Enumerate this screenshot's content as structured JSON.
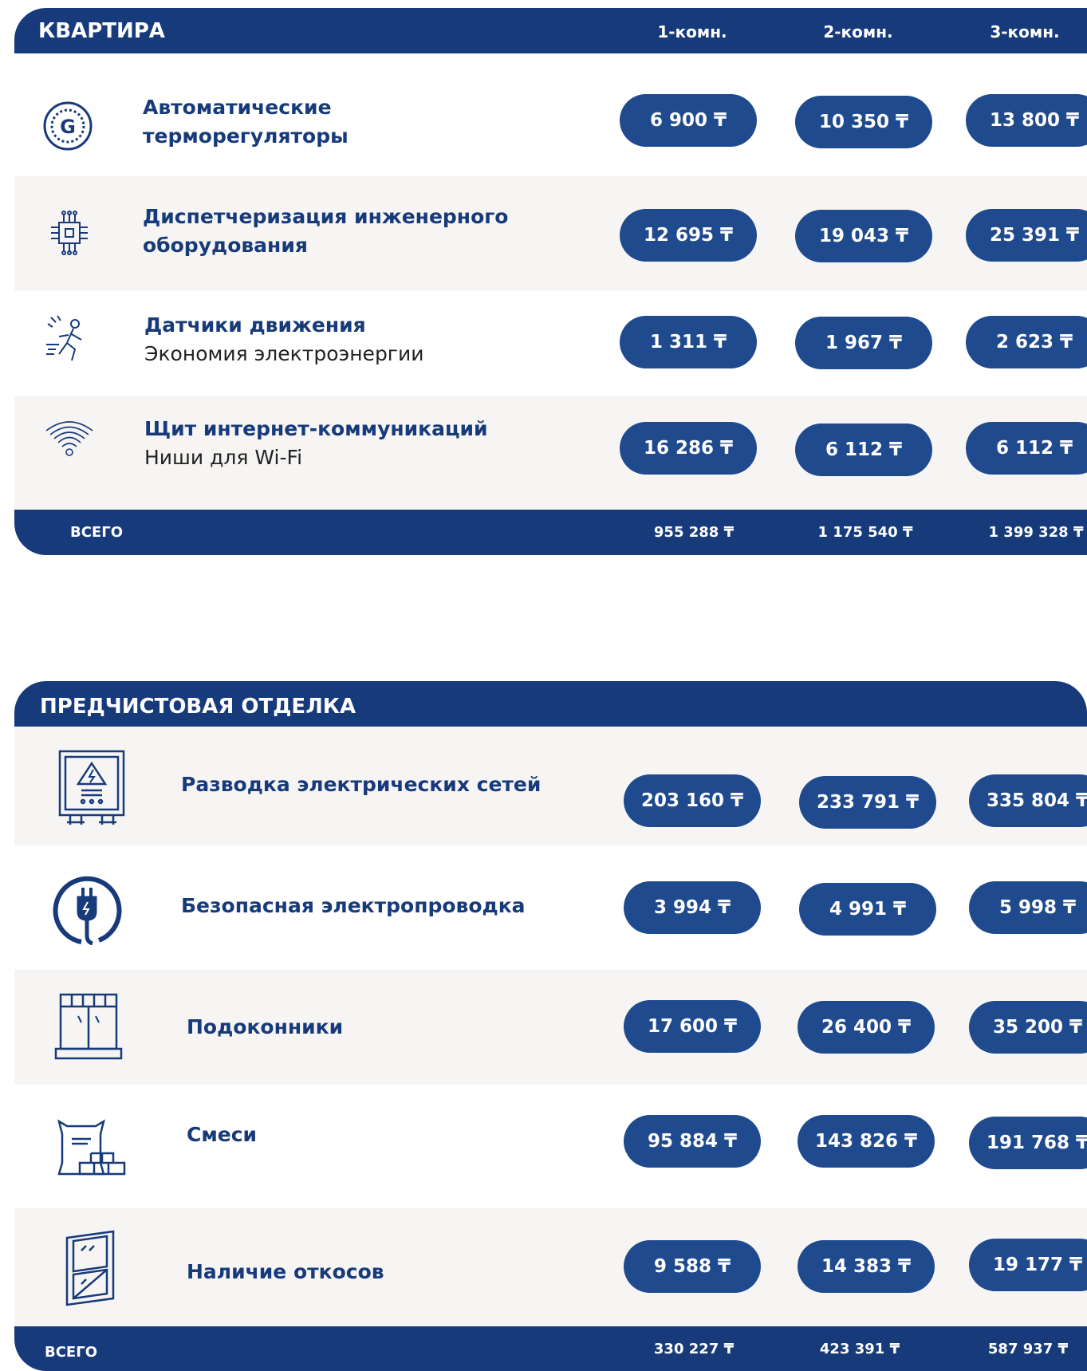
{
  "apartment": {
    "title": "КВАРТИРА",
    "columns": [
      "1-комн.",
      "2-комн.",
      "3-комн."
    ],
    "rows": [
      {
        "icon": "thermostat-icon",
        "title": "Автоматические терморегуляторы",
        "subtitle": "",
        "prices": [
          "6 900 ₸",
          "10 350 ₸",
          "13 800 ₸"
        ]
      },
      {
        "icon": "chip-icon",
        "title": "Диспетчеризация инженерного оборудования",
        "subtitle": "",
        "prices": [
          "12 695 ₸",
          "19 043 ₸",
          "25 391 ₸"
        ]
      },
      {
        "icon": "motion-sensor-icon",
        "title": "Датчики движения",
        "subtitle": "Экономия электроэнергии",
        "prices": [
          "1 311 ₸",
          "1 967 ₸",
          "2 623 ₸"
        ]
      },
      {
        "icon": "wifi-icon",
        "title": "Щит интернет-коммуникаций",
        "subtitle": "Ниши для Wi-Fi",
        "prices": [
          "16 286 ₸",
          "6 112 ₸",
          "6 112 ₸"
        ]
      }
    ],
    "total_label": "ВСЕГО",
    "totals": [
      "955 288 ₸",
      "1 175 540 ₸",
      "1 399 328 ₸"
    ]
  },
  "prefinish": {
    "title": "ПРЕДЧИСТОВАЯ ОТДЕЛКА",
    "rows": [
      {
        "icon": "electrical-panel-icon",
        "title": "Разводка электрических сетей",
        "prices": [
          "203 160 ₸",
          "233 791 ₸",
          "335 804 ₸"
        ]
      },
      {
        "icon": "power-plug-icon",
        "title": "Безопасная электропроводка",
        "prices": [
          "3 994 ₸",
          "4 991 ₸",
          "5 998 ₸"
        ]
      },
      {
        "icon": "window-sill-icon",
        "title": "Подоконники",
        "prices": [
          "17 600 ₸",
          "26 400 ₸",
          "35 200 ₸"
        ]
      },
      {
        "icon": "cement-bag-icon",
        "title": "Смеси",
        "prices": [
          "95 884 ₸",
          "143 826 ₸",
          "191 768 ₸"
        ]
      },
      {
        "icon": "window-slope-icon",
        "title": "Наличие откосов",
        "prices": [
          "9 588 ₸",
          "14 383 ₸",
          "19 177 ₸"
        ]
      }
    ],
    "total_label": "ВСЕГО",
    "totals": [
      "330 227 ₸",
      "423 391 ₸",
      "587 937 ₸"
    ]
  }
}
